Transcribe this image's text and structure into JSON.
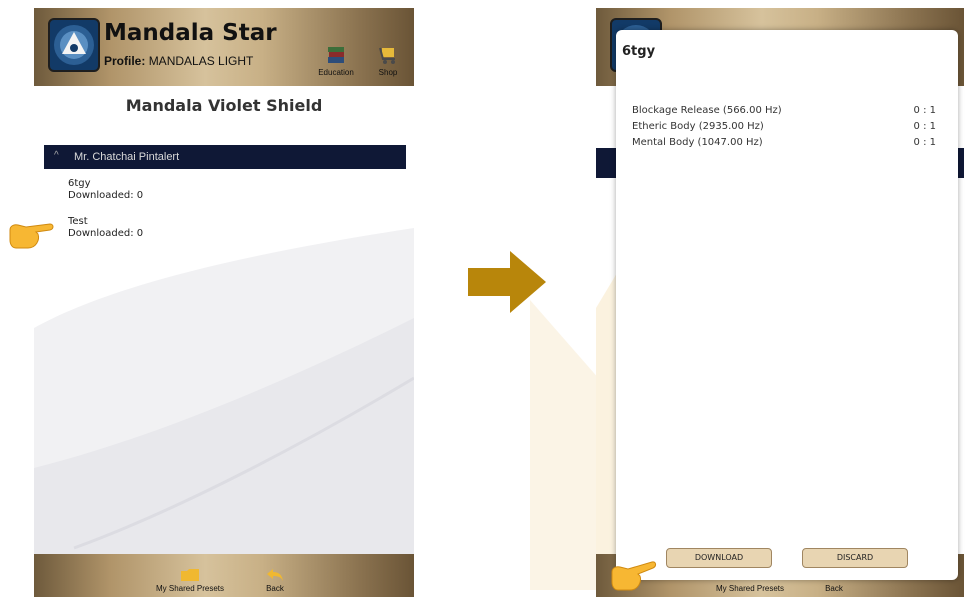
{
  "left": {
    "app_title": "Mandala Star",
    "profile_label": "Profile:",
    "profile_name": "MANDALAS LIGHT",
    "education_label": "Education",
    "shop_label": "Shop",
    "section_title": "Mandala Violet Shield",
    "group_name": "Mr. Chatchai Pintalert",
    "group_chevron": "^",
    "presets": [
      {
        "name": "6tgy",
        "downloaded": "Downloaded: 0"
      },
      {
        "name": "Test",
        "downloaded": "Downloaded: 0"
      }
    ],
    "footer_shared": "My Shared Presets",
    "footer_back": "Back"
  },
  "right": {
    "modal_title": "6tgy",
    "frequencies": [
      {
        "label": "Blockage Release (566.00 Hz)",
        "ratio": "0 : 1"
      },
      {
        "label": "Etheric Body (2935.00 Hz)",
        "ratio": "0 : 1"
      },
      {
        "label": "Mental Body (1047.00 Hz)",
        "ratio": "0 : 1"
      }
    ],
    "download_label": "DOWNLOAD",
    "discard_label": "DISCARD",
    "footer_shared": "My Shared Presets",
    "footer_back": "Back"
  },
  "icons": {
    "transition_arrow": "arrow-right-icon",
    "pointer": "pointing-hand-icon",
    "education": "books-icon",
    "shop": "cart-icon",
    "shared_presets": "folder-icon",
    "back": "back-arrow-icon"
  },
  "colors": {
    "gold_accent": "#c8b086",
    "navy_bar": "#0f1836",
    "button_fill": "#e8d5b2",
    "arrow": "#b8860b"
  }
}
